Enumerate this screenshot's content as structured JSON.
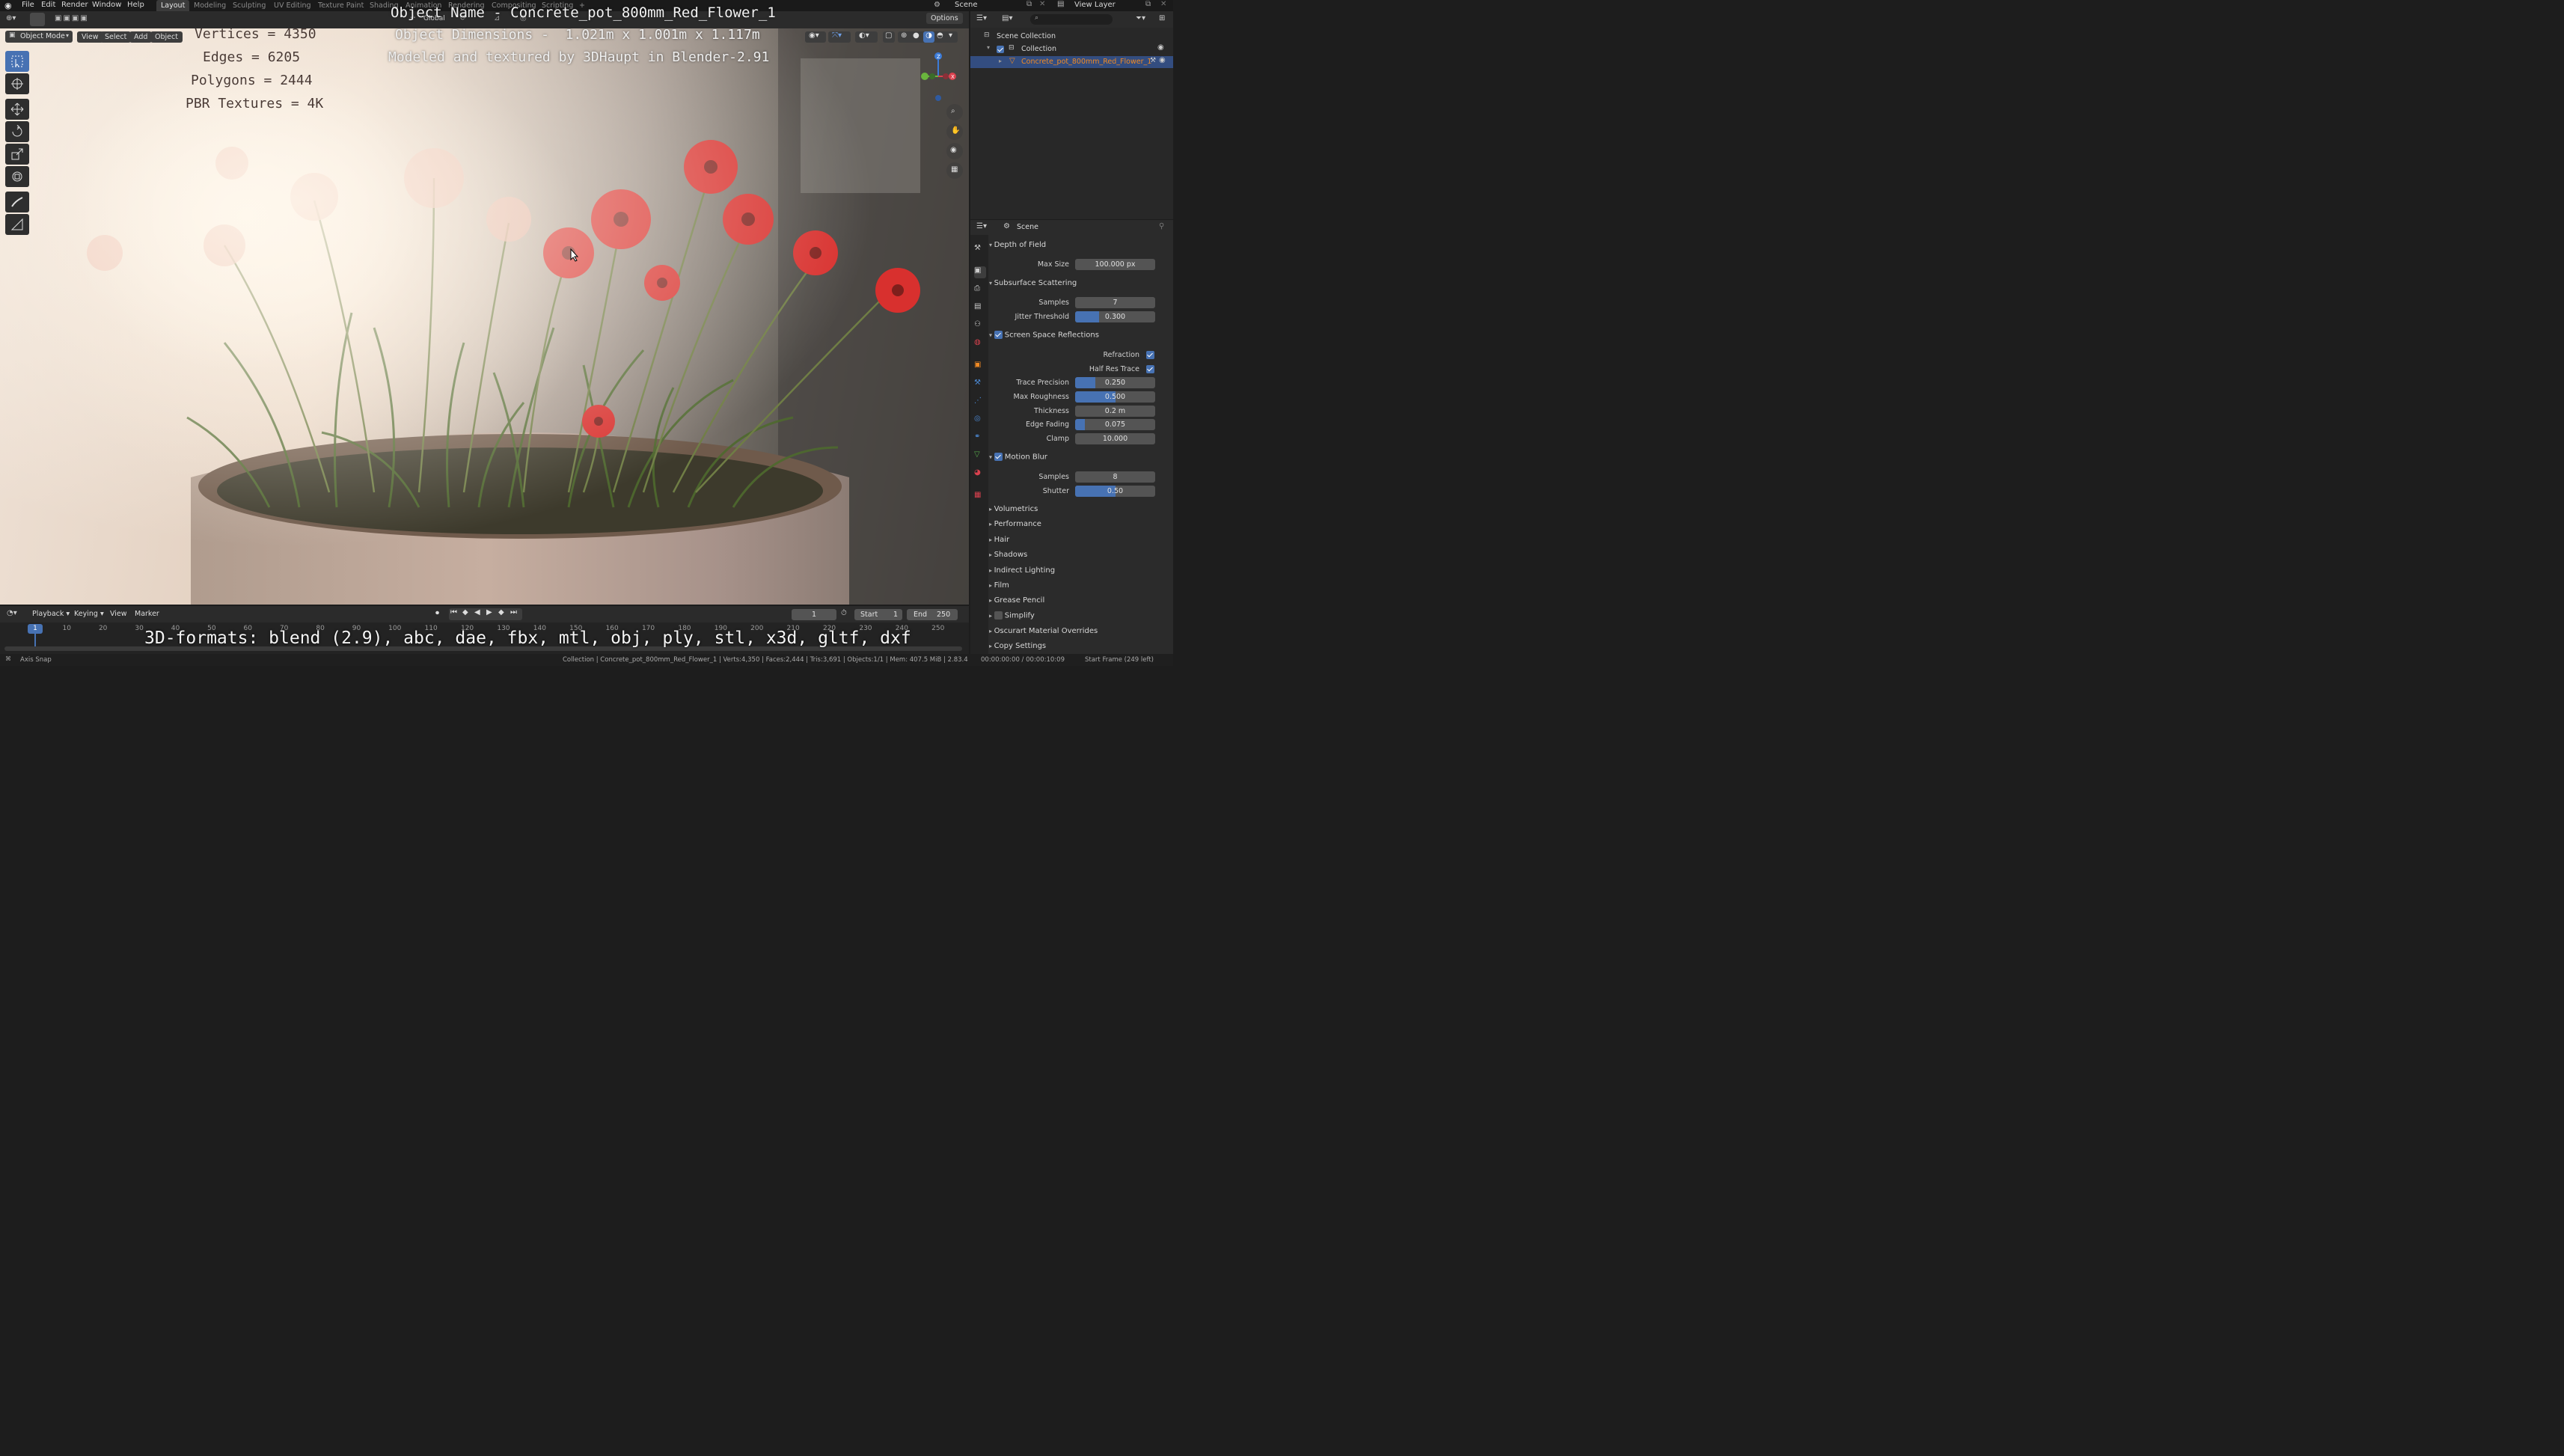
{
  "topbar": {
    "menu": [
      "File",
      "Edit",
      "Render",
      "Window",
      "Help"
    ],
    "workspaces": [
      "Layout",
      "Modeling",
      "Sculpting",
      "UV Editing",
      "Texture Paint",
      "Shading",
      "Animation",
      "Rendering",
      "Compositing",
      "Scripting"
    ],
    "active_workspace": "Layout",
    "plus": "+",
    "scene_label": "Scene",
    "view_layer_label": "View Layer"
  },
  "viewport_header": {
    "mode": "Object Mode",
    "menu": [
      "View",
      "Select",
      "Add",
      "Object"
    ],
    "transform_orientation": "Global",
    "options": "Options"
  },
  "overlay": {
    "object_name": "Object Name - Concrete_pot_800mm_Red_Flower_1",
    "dimensions": "Object Dimensions -  1.021m x 1.001m x 1.117m",
    "credit": "Modeled and textured by 3DHaupt in Blender-2.91",
    "vertices": "Vertices = 4350",
    "edges": "Edges = 6205",
    "polygons": "Polygons = 2444",
    "textures": "PBR Textures = 4K",
    "formats": "3D-formats: blend (2.9), abc, dae, fbx, mtl, obj, ply, stl, x3d, gltf, dxf"
  },
  "gizmo": {
    "z": "Z",
    "y": "Y",
    "x": "X"
  },
  "outliner": {
    "root": "Scene Collection",
    "collection": "Collection",
    "object": "Concrete_pot_800mm_Red_Flower_1"
  },
  "properties": {
    "context": "Scene",
    "sections": [
      {
        "title": "Depth of Field",
        "open": true,
        "fields": [
          {
            "label": "Max Size",
            "value": "100.000 px",
            "fill": 0
          }
        ]
      },
      {
        "title": "Subsurface Scattering",
        "open": true,
        "fields": [
          {
            "label": "Samples",
            "value": "7",
            "fill": 0
          },
          {
            "label": "Jitter Threshold",
            "value": "0.300",
            "fill": 0.3
          }
        ]
      },
      {
        "title": "Screen Space Reflections",
        "open": true,
        "checked": true,
        "checks": [
          {
            "label": "Refraction",
            "checked": true
          },
          {
            "label": "Half Res Trace",
            "checked": true
          }
        ],
        "fields": [
          {
            "label": "Trace Precision",
            "value": "0.250",
            "fill": 0.25
          },
          {
            "label": "Max Roughness",
            "value": "0.500",
            "fill": 0.5
          },
          {
            "label": "Thickness",
            "value": "0.2 m",
            "fill": 0
          },
          {
            "label": "Edge Fading",
            "value": "0.075",
            "fill": 0.12
          },
          {
            "label": "Clamp",
            "value": "10.000",
            "fill": 0
          }
        ]
      },
      {
        "title": "Motion Blur",
        "open": true,
        "checked": true,
        "fields": [
          {
            "label": "Samples",
            "value": "8",
            "fill": 0
          },
          {
            "label": "Shutter",
            "value": "0.50",
            "fill": 0.5
          }
        ]
      }
    ],
    "collapsed": [
      "Volumetrics",
      "Performance",
      "Hair",
      "Shadows",
      "Indirect Lighting",
      "Film",
      "Grease Pencil",
      "Simplify",
      "Oscurart Material Overrides",
      "Copy Settings"
    ]
  },
  "timeline": {
    "menu": [
      "Playback",
      "Keying",
      "View",
      "Marker"
    ],
    "current_frame": "1",
    "start_label": "Start",
    "start": "1",
    "end_label": "End",
    "end": "250",
    "ticks": [
      "1",
      "10",
      "20",
      "30",
      "40",
      "50",
      "60",
      "70",
      "80",
      "90",
      "100",
      "110",
      "120",
      "130",
      "140",
      "150",
      "160",
      "170",
      "180",
      "190",
      "200",
      "210",
      "220",
      "230",
      "240",
      "250"
    ]
  },
  "status": {
    "left": "Axis Snap",
    "stats": "Collection | Concrete_pot_800mm_Red_Flower_1 | Verts:4,350 | Faces:2,444 | Tris:3,691 | Objects:1/1 | Mem: 407.5 MiB | 2.83.4",
    "time": "00:00:00:00 / 00:00:10:09",
    "start_frame": "Start Frame (249 left)"
  },
  "colors": {
    "accent": "#4772b3",
    "flower_red": "#d8302e",
    "object_name": "#f08a24"
  }
}
